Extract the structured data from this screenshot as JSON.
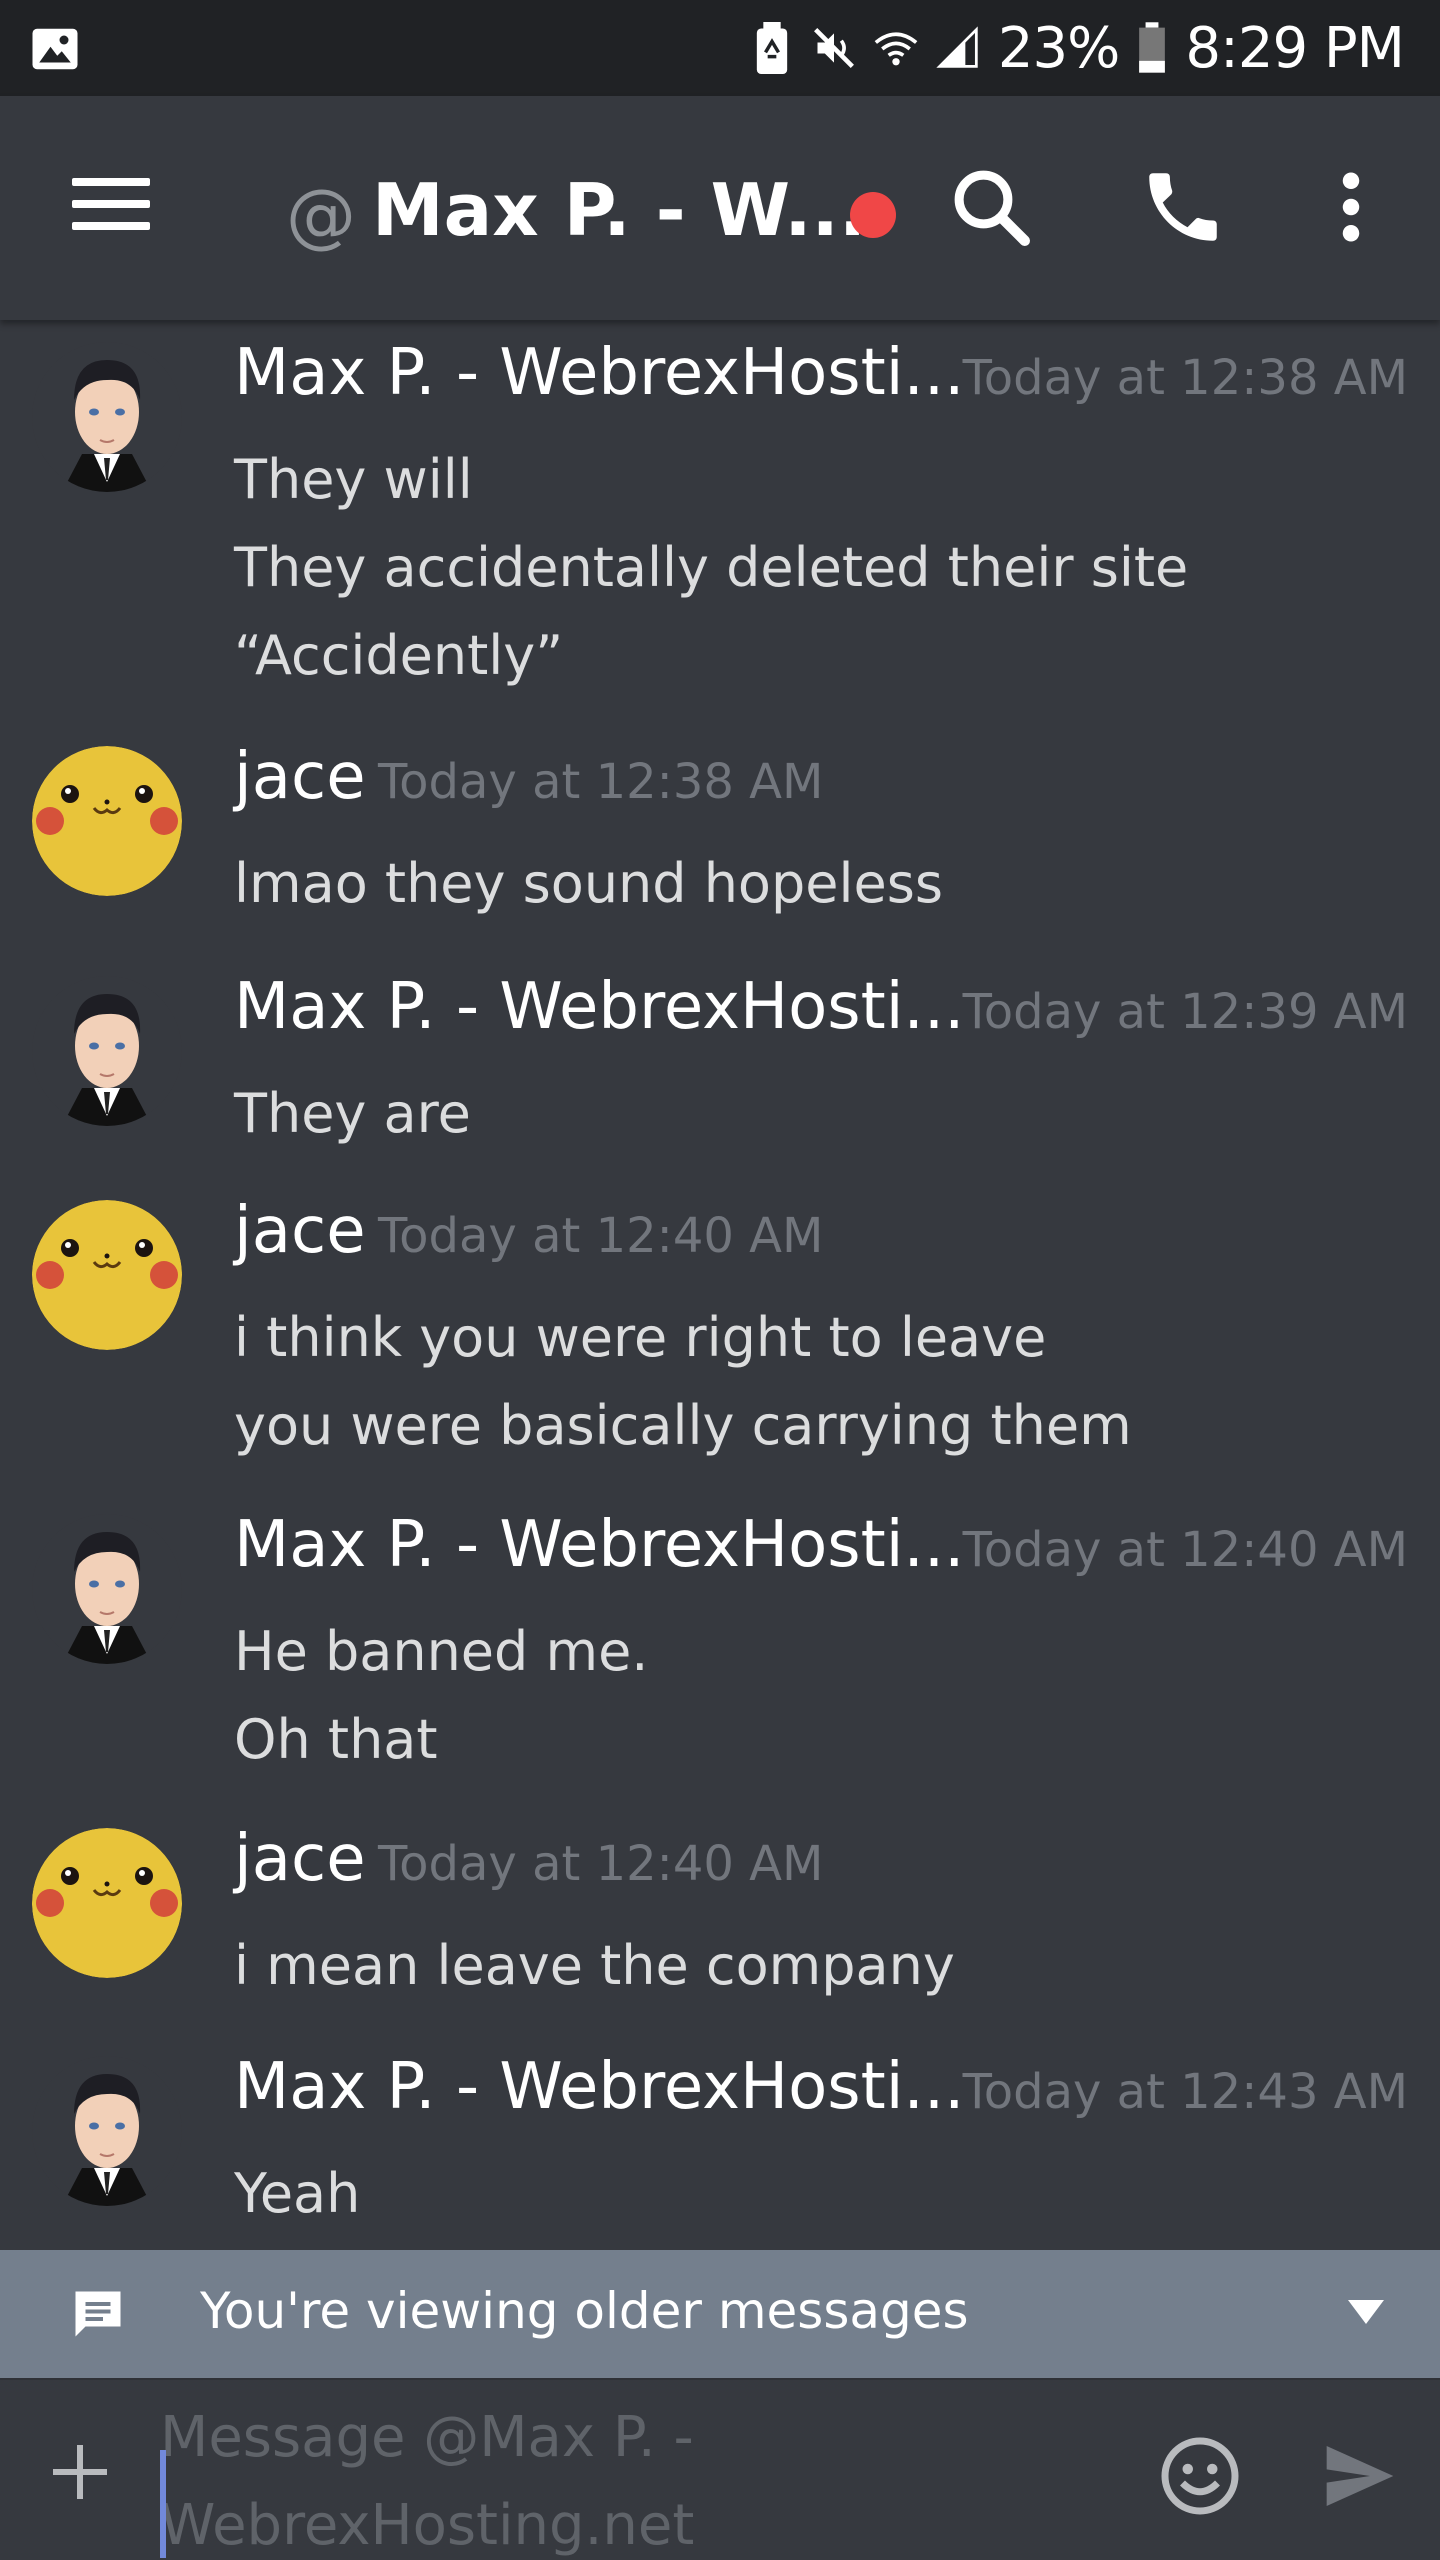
{
  "status_bar": {
    "battery_percent": "23%",
    "time": "8:29 PM",
    "icons": [
      "image-icon",
      "battery-saver-icon",
      "mute-icon",
      "wifi-icon",
      "signal-icon",
      "battery-icon"
    ]
  },
  "header": {
    "prefix": "@",
    "title": "Max P. - W...",
    "status": "dnd",
    "status_color": "#f04747",
    "icons": [
      "menu-icon",
      "search-icon",
      "phone-icon",
      "more-vertical-icon"
    ]
  },
  "messages": [
    {
      "author": "Max P. - WebrexHosti...",
      "avatar": "businessman-avatar",
      "timestamp": "Today at 12:38 AM",
      "lines": [
        "They will",
        "They accidentally deleted their site",
        "“Accidently”"
      ]
    },
    {
      "author": "jace",
      "avatar": "pikachu-avatar",
      "timestamp": "Today at 12:38 AM",
      "lines": [
        "lmao they sound hopeless"
      ]
    },
    {
      "author": "Max P. - WebrexHosti...",
      "avatar": "businessman-avatar",
      "timestamp": "Today at 12:39 AM",
      "lines": [
        "They are"
      ]
    },
    {
      "author": "jace",
      "avatar": "pikachu-avatar",
      "timestamp": "Today at 12:40 AM",
      "lines": [
        "i think you were right to leave",
        "you were basically carrying them"
      ]
    },
    {
      "author": "Max P. - WebrexHosti...",
      "avatar": "businessman-avatar",
      "timestamp": "Today at 12:40 AM",
      "lines": [
        "He banned me.",
        "Oh that"
      ]
    },
    {
      "author": "jace",
      "avatar": "pikachu-avatar",
      "timestamp": "Today at 12:40 AM",
      "lines": [
        "i mean leave the company"
      ]
    },
    {
      "author": "Max P. - WebrexHosti...",
      "avatar": "businessman-avatar",
      "timestamp": "Today at 12:43 AM",
      "lines": [
        "Yeah"
      ]
    }
  ],
  "older_bar": {
    "text": "You're viewing older messages",
    "bg_color": "#747f8d"
  },
  "composer": {
    "placeholder": "Message @Max P. - WebrexHosting.net",
    "placeholder_line1": "Message @Max P. -",
    "placeholder_line2": "WebrexHosting.net",
    "icons": [
      "plus-icon",
      "emoji-icon",
      "send-icon"
    ]
  },
  "colors": {
    "background": "#36393f",
    "statusbar": "#202225",
    "timestamp": "#72767d",
    "accent": "#7289da"
  }
}
